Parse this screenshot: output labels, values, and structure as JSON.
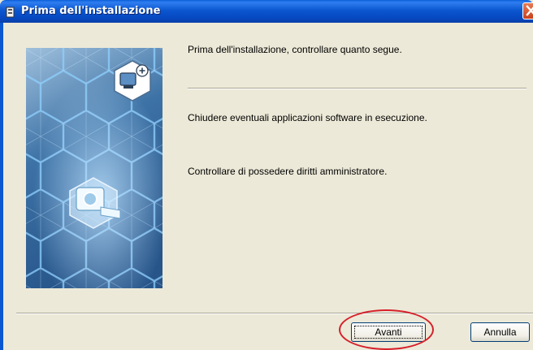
{
  "window": {
    "title": "Prima dell'installazione",
    "icons": {
      "app": "installer-icon",
      "close": "close-icon"
    }
  },
  "content": {
    "heading": "Prima dell'installazione, controllare quanto segue.",
    "item1": "Chiudere eventuali applicazioni software in esecuzione.",
    "item2": "Controllare di possedere diritti amministratore."
  },
  "buttons": {
    "next": "Avanti",
    "cancel": "Annulla"
  },
  "colors": {
    "titlebar": "#0b57d0",
    "highlight_ring": "#d6202a",
    "dialog_bg": "#ece9d8"
  }
}
